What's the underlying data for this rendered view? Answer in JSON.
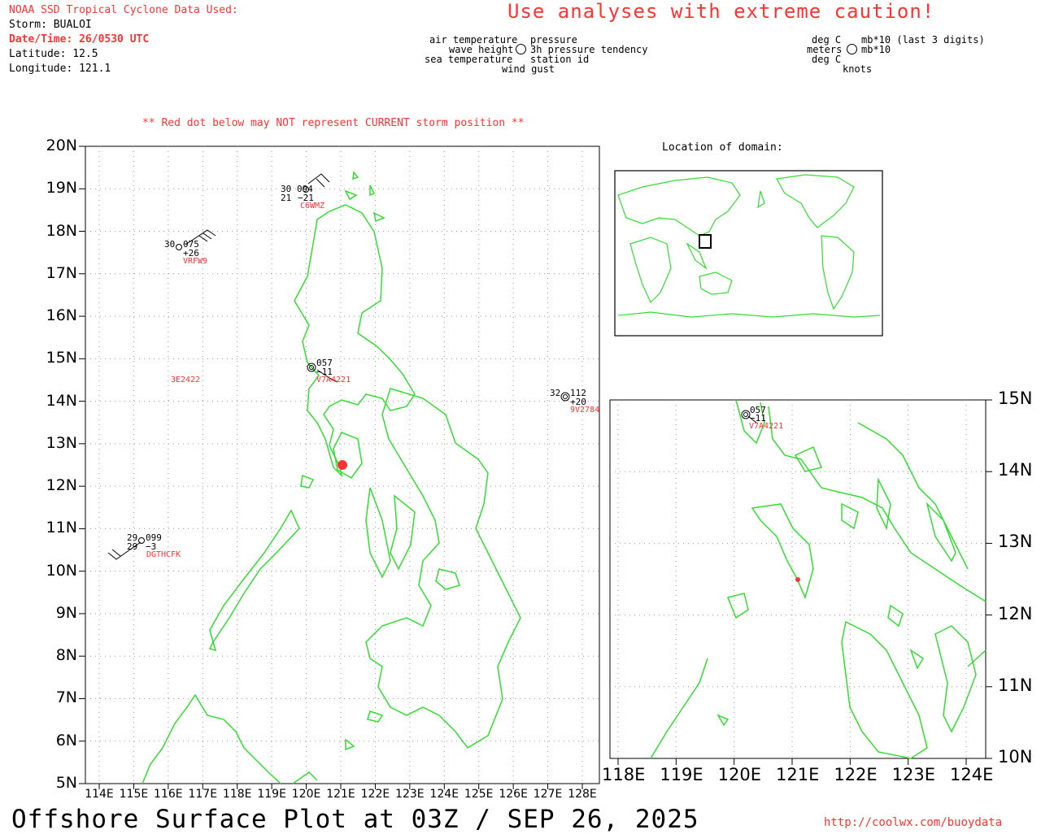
{
  "header": {
    "source_title": "NOAA SSD Tropical Cyclone Data Used:",
    "storm": "Storm: BUALOI",
    "datetime": "Date/Time: 26/0530 UTC",
    "latitude": "Latitude: 12.5",
    "longitude": "Longitude: 121.1",
    "caution": "Use analyses with extreme caution!",
    "red_dot_note": "** Red dot below may NOT represent CURRENT storm position **"
  },
  "legend_left": {
    "air_temperature": "air temperature",
    "pressure": "pressure",
    "wave_height": "wave height",
    "pressure_tendency": "3h pressure tendency",
    "sea_temperature": "sea temperature",
    "station_id": "station id",
    "wind_gust": "wind gust"
  },
  "legend_right": {
    "deg_c_top": "deg C",
    "mb": "mb*10 (last 3 digits)",
    "meters": "meters",
    "mb10": "mb*10",
    "deg_c_bottom": "deg C",
    "knots": "knots"
  },
  "inset": {
    "title": "Location of domain:"
  },
  "main_map": {
    "lat_labels": [
      "20N",
      "19N",
      "18N",
      "17N",
      "16N",
      "15N",
      "14N",
      "13N",
      "12N",
      "11N",
      "10N",
      "9N",
      "8N",
      "7N",
      "6N",
      "5N"
    ],
    "lon_labels": [
      "114E",
      "115E",
      "116E",
      "117E",
      "118E",
      "119E",
      "120E",
      "121E",
      "122E",
      "123E",
      "124E",
      "125E",
      "126E",
      "127E",
      "128E"
    ],
    "stations": [
      {
        "id": "C6WMZ",
        "air": "30",
        "pressure": "094",
        "sea": "21",
        "tendency": "−21"
      },
      {
        "id": "VRFW9",
        "air": "30",
        "pressure": "075",
        "tendency": "+26"
      },
      {
        "id": "V7A4221",
        "pressure": "057",
        "tendency": "−11"
      },
      {
        "id": "3E2422"
      },
      {
        "id": "9V2784",
        "air": "32",
        "pressure": "112",
        "tendency": "+20"
      },
      {
        "id": "DGTHCFK",
        "air": "29",
        "pressure": "099",
        "sea": "29",
        "tendency": "−3"
      }
    ],
    "storm_position": {
      "lat": 12.5,
      "lon": 121.1
    }
  },
  "zoom_map": {
    "lat_labels": [
      "15N",
      "14N",
      "13N",
      "12N",
      "11N",
      "10N"
    ],
    "lon_labels": [
      "118E",
      "119E",
      "120E",
      "121E",
      "122E",
      "123E",
      "124E"
    ],
    "station": {
      "id": "V7A4221",
      "pressure": "057",
      "tendency": "−11"
    }
  },
  "footer": {
    "title": "Offshore Surface Plot at 03Z / SEP 26, 2025",
    "url": "http://coolwx.com/buoydata"
  },
  "colors": {
    "coast": "#33dd33",
    "label_red": "#ff3333",
    "grid": "#999999"
  }
}
